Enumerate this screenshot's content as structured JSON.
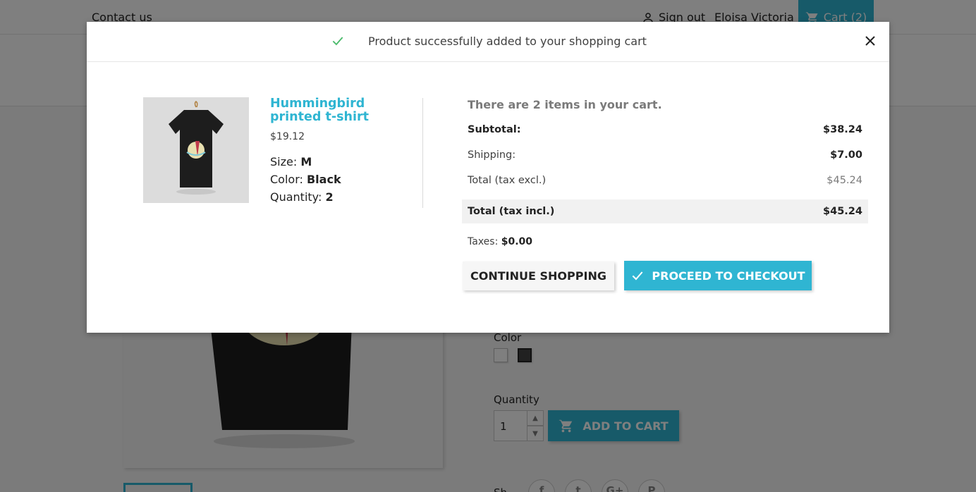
{
  "header": {
    "contact_label": "Contact us",
    "signout_label": "Sign out",
    "user_name": "Eloisa Victoria",
    "cart_label": "Cart (2)"
  },
  "product_page": {
    "color_label": "Color",
    "quantity_label": "Quantity",
    "quantity_value": "1",
    "add_to_cart_label": "ADD TO CART",
    "share_label": "Sh"
  },
  "modal": {
    "title": "Product successfully added to your shopping cart",
    "product": {
      "name": "Hummingbird printed t-shirt",
      "price": "$19.12",
      "size_label": "Size:",
      "size_value": "M",
      "color_label": "Color:",
      "color_value": "Black",
      "quantity_label": "Quantity:",
      "quantity_value": "2"
    },
    "summary": {
      "count_text": "There are 2 items in your cart.",
      "subtotal_label": "Subtotal:",
      "subtotal_value": "$38.24",
      "shipping_label": "Shipping:",
      "shipping_value": "$7.00",
      "total_excl_label": "Total (tax excl.)",
      "total_excl_value": "$45.24",
      "total_incl_label": "Total (tax incl.)",
      "total_incl_value": "$45.24",
      "taxes_label": "Taxes:",
      "taxes_value": "$0.00"
    },
    "continue_label": "CONTINUE SHOPPING",
    "checkout_label": "PROCEED TO CHECKOUT"
  },
  "colors": {
    "accent": "#2fb5d2",
    "success": "#4cbb6c"
  }
}
